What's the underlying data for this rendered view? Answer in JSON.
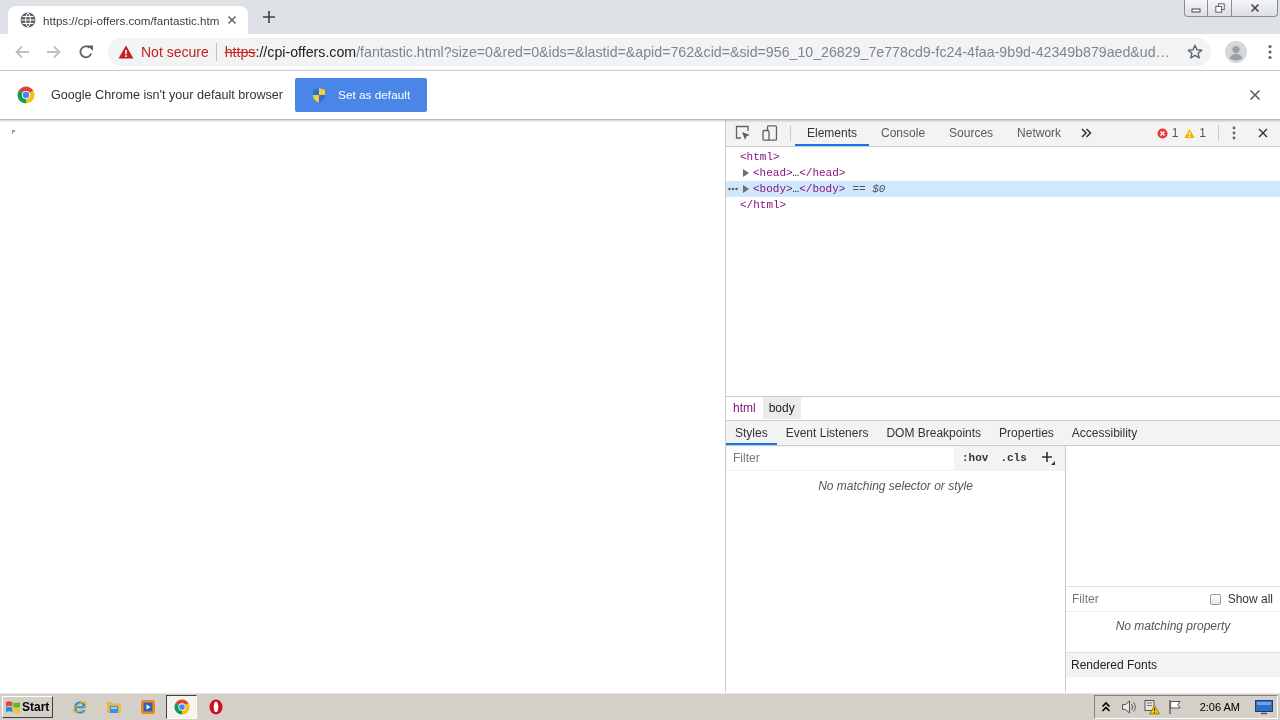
{
  "browser": {
    "tabs": [
      {
        "title": "https://cpi-offers.com/fantastic.htm",
        "selected": true
      }
    ],
    "nav_buttons": [
      {
        "kind": "back",
        "disabled": true
      },
      {
        "kind": "forward",
        "disabled": true
      },
      {
        "kind": "reload",
        "disabled": false
      }
    ],
    "address_bar": {
      "security_label": "Not secure",
      "scheme": "https",
      "host": "://cpi-offers.com",
      "path": "/fantastic.html?size=0&red=0&ids=&lastid=&apid=762&cid=&sid=956_10_26829_7e778cd9-fc24-4faa-9b9d-42349b879aed&ud…"
    },
    "infobar": {
      "message": "Google Chrome isn't your default browser",
      "button": "Set as default"
    }
  },
  "devtools": {
    "tabs": [
      {
        "label": "Elements",
        "selected": true
      },
      {
        "label": "Console",
        "selected": false
      },
      {
        "label": "Sources",
        "selected": false
      },
      {
        "label": "Network",
        "selected": false
      }
    ],
    "error_count": "1",
    "warning_count": "1",
    "dom_tree": [
      {
        "open_tag": "<html>",
        "close_tag": "</html>",
        "expanded": true,
        "selected": false,
        "children": [
          {
            "open_tag": "<head>",
            "ellipsis": "…",
            "close_tag": "</head>",
            "expanded": false,
            "selected": false
          },
          {
            "open_tag": "<body>",
            "ellipsis": "…",
            "close_tag": "</body>",
            "expanded": false,
            "selected": true,
            "marker": "== *$0*"
          }
        ]
      }
    ],
    "breadcrumbs": [
      {
        "label": "html",
        "selected": false
      },
      {
        "label": "body",
        "selected": true
      }
    ],
    "sidebar_tabs": [
      {
        "label": "Styles",
        "selected": true
      },
      {
        "label": "Event Listeners",
        "selected": false
      },
      {
        "label": "DOM Breakpoints",
        "selected": false
      },
      {
        "label": "Properties",
        "selected": false
      },
      {
        "label": "Accessibility",
        "selected": false
      }
    ],
    "styles": {
      "filter_placeholder": "Filter",
      "hover_toggle": ":hov",
      "class_toggle": ".cls",
      "empty_message": "No matching selector or style"
    },
    "computed": {
      "filter_placeholder": "Filter",
      "show_all": {
        "label": "Show all",
        "checked": false
      },
      "empty_message": "No matching property",
      "section_title": "Rendered Fonts"
    }
  },
  "taskbar": {
    "start_label": "Start",
    "apps": [
      {
        "kind": "ie",
        "selected": false
      },
      {
        "kind": "explorer",
        "selected": false
      },
      {
        "kind": "media",
        "selected": false
      },
      {
        "kind": "chrome",
        "selected": true
      },
      {
        "kind": "opera",
        "selected": false
      }
    ],
    "clock": "2:06 AM"
  }
}
